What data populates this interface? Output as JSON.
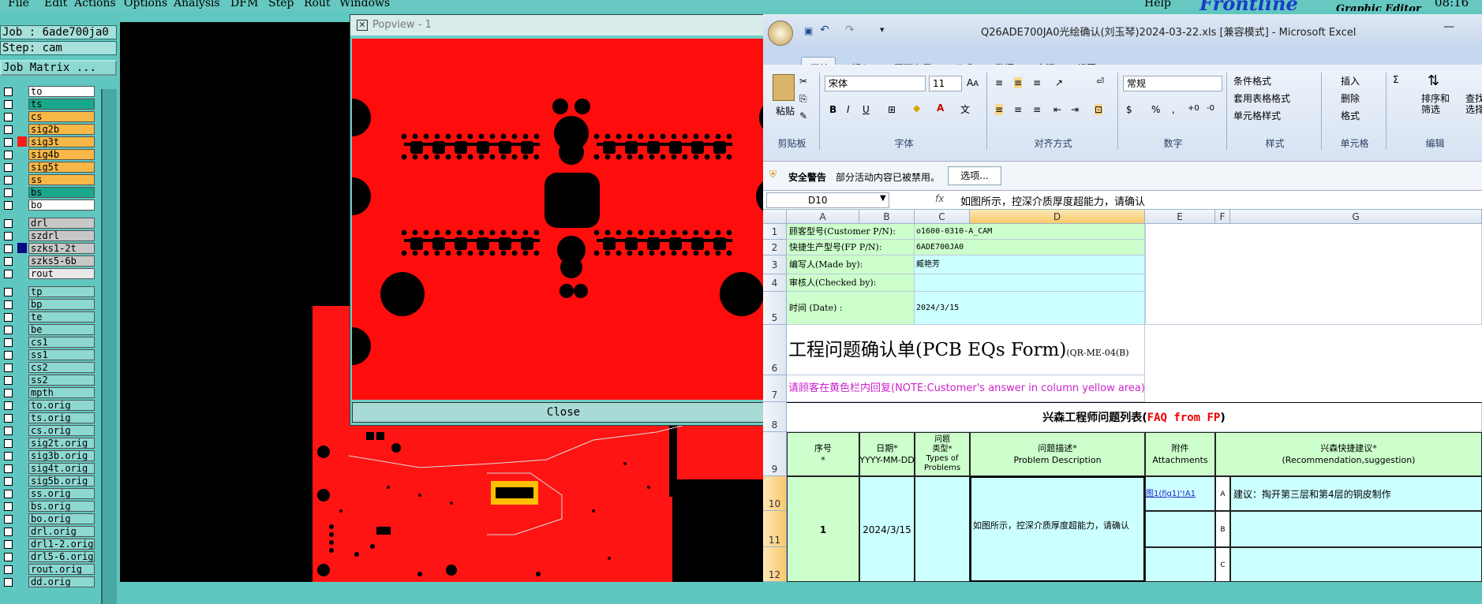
{
  "menubar": {
    "items": [
      "File",
      "Edit",
      "Actions",
      "Options",
      "Analysis",
      "DFM",
      "Step",
      "Rout",
      "Windows"
    ],
    "help": "Help",
    "brand": "Frontline",
    "brand_sub": "Graphic Editor",
    "clock": "08:16"
  },
  "job": {
    "job_label": "Job : 6ade700ja0",
    "step_label": "Step: cam",
    "matrix_button": "Job Matrix ..."
  },
  "layers": [
    {
      "name": "to",
      "color": "#ffffff",
      "mark": ""
    },
    {
      "name": "ts",
      "color": "#1aa88c",
      "mark": ""
    },
    {
      "name": "cs",
      "color": "#f7b847",
      "mark": ""
    },
    {
      "name": "sig2b",
      "color": "#f7b847",
      "mark": ""
    },
    {
      "name": "sig3t",
      "color": "#f7b847",
      "mark": "#ff1a1a"
    },
    {
      "name": "sig4b",
      "color": "#f7b847",
      "mark": ""
    },
    {
      "name": "sig5t",
      "color": "#f7b847",
      "mark": ""
    },
    {
      "name": "ss",
      "color": "#f7b847",
      "mark": ""
    },
    {
      "name": "bs",
      "color": "#1aa88c",
      "mark": ""
    },
    {
      "name": "bo",
      "color": "#ffffff",
      "mark": ""
    },
    {
      "name": "drl",
      "color": "#c8c8c8",
      "mark": ""
    },
    {
      "name": "szdrl",
      "color": "#c8c8c8",
      "mark": ""
    },
    {
      "name": "szks1-2t",
      "color": "#c8c8c8",
      "mark": "#0a0a80"
    },
    {
      "name": "szks5-6b",
      "color": "#c8c8c8",
      "mark": ""
    },
    {
      "name": "rout",
      "color": "#e8e8e8",
      "mark": ""
    },
    {
      "name": "tp",
      "color": "#8ed8d2",
      "mark": ""
    },
    {
      "name": "bp",
      "color": "#8ed8d2",
      "mark": ""
    },
    {
      "name": "te",
      "color": "#8ed8d2",
      "mark": ""
    },
    {
      "name": "be",
      "color": "#8ed8d2",
      "mark": ""
    },
    {
      "name": "cs1",
      "color": "#8ed8d2",
      "mark": ""
    },
    {
      "name": "ss1",
      "color": "#8ed8d2",
      "mark": ""
    },
    {
      "name": "cs2",
      "color": "#8ed8d2",
      "mark": ""
    },
    {
      "name": "ss2",
      "color": "#8ed8d2",
      "mark": ""
    },
    {
      "name": "mpth",
      "color": "#8ed8d2",
      "mark": ""
    },
    {
      "name": "to.orig",
      "color": "#8ed8d2",
      "mark": ""
    },
    {
      "name": "ts.orig",
      "color": "#8ed8d2",
      "mark": ""
    },
    {
      "name": "cs.orig",
      "color": "#8ed8d2",
      "mark": ""
    },
    {
      "name": "sig2t.orig",
      "color": "#8ed8d2",
      "mark": ""
    },
    {
      "name": "sig3b.orig",
      "color": "#8ed8d2",
      "mark": ""
    },
    {
      "name": "sig4t.orig",
      "color": "#8ed8d2",
      "mark": ""
    },
    {
      "name": "sig5b.orig",
      "color": "#8ed8d2",
      "mark": ""
    },
    {
      "name": "ss.orig",
      "color": "#8ed8d2",
      "mark": ""
    },
    {
      "name": "bs.orig",
      "color": "#8ed8d2",
      "mark": ""
    },
    {
      "name": "bo.orig",
      "color": "#8ed8d2",
      "mark": ""
    },
    {
      "name": "drl.orig",
      "color": "#8ed8d2",
      "mark": ""
    },
    {
      "name": "drl1-2.orig",
      "color": "#8ed8d2",
      "mark": ""
    },
    {
      "name": "drl5-6.orig",
      "color": "#8ed8d2",
      "mark": ""
    },
    {
      "name": "rout.orig",
      "color": "#8ed8d2",
      "mark": ""
    },
    {
      "name": "dd.orig",
      "color": "#8ed8d2",
      "mark": ""
    }
  ],
  "popview": {
    "title": "Popview - 1",
    "close_label": "Close"
  },
  "excel": {
    "title": "Q26ADE700JA0光绘确认(刘玉琴)2024-03-22.xls [兼容模式] - Microsoft Excel",
    "tabs": [
      "开始",
      "插入",
      "页面布局",
      "公式",
      "数据",
      "审阅",
      "视图"
    ],
    "ribbon": {
      "paste": "粘贴",
      "clipboard": "剪贴板",
      "font_name": "宋体",
      "font_size": "11",
      "font_group": "字体",
      "align_group": "对齐方式",
      "number_format": "常规",
      "number_group": "数字",
      "cond_format": "条件格式",
      "table_format": "套用表格格式",
      "cell_style": "单元格样式",
      "style_group": "样式",
      "insert": "插入",
      "delete": "删除",
      "format": "格式",
      "cells_group": "单元格",
      "sort_filter": "排序和\n筛选",
      "find": "查找和\n选择",
      "edit_group": "编辑"
    },
    "security": {
      "title": "安全警告",
      "message": "部分活动内容已被禁用。",
      "options": "选项..."
    },
    "namebox": "D10",
    "fx": "fx",
    "formula": "如图所示，控深介质厚度超能力，请确认",
    "columns": [
      "A",
      "B",
      "C",
      "D",
      "E",
      "F",
      "G"
    ],
    "rows": [
      "1",
      "2",
      "3",
      "4",
      "5",
      "6",
      "7",
      "8",
      "9",
      "10",
      "11",
      "12"
    ],
    "cells": {
      "a1": "顾客型号(Customer P/N):",
      "c1": "o1600-0310-A_CAM",
      "a2": "快捷生产型号(FP P/N):",
      "c2": "6ADE700JA0",
      "a3": "编写人(Made by):",
      "c3": "臧艳芳",
      "a4": "审核人(Checked by):",
      "a5": "时间 (Date) :",
      "c5": "2024/3/15",
      "a6": "工程问题确认单(PCB EQs Form)",
      "a6b": "(QR-ME-04(B)",
      "a7": "请顾客在黄色栏内回复(NOTE:Customer's answer in column yellow area)",
      "r8a": "兴森工程师问题列表(",
      "r8b": "FAQ from FP",
      ")": ")",
      "h_seq": "序号\n*",
      "h_date": "日期*\nYYYY-MM-DD",
      "h_type": "问题\n类型*\nTypes of\nProblems",
      "h_desc": "问题描述*\nProblem Description",
      "h_att": "附件\nAttachments",
      "h_sugg": "兴森快捷建议*\n(Recommendation,suggestion)",
      "seq": "1",
      "date": "2024/3/15",
      "desc": "如图所示，控深介质厚度超能力，请确认",
      "att": "图1(fig1)'!A1",
      "optA": "A",
      "optB": "B",
      "optC": "C",
      "suggA": "建议：掏开第三层和第4层的铜皮制作"
    }
  }
}
